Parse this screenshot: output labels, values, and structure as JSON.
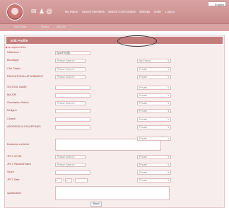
{
  "header": {
    "language": "English",
    "icons": [
      "envelope-icon",
      "people-icon",
      "at-icon"
    ],
    "nav": [
      "My Home",
      "Search Members",
      "Search Communities",
      "Settings",
      "Invite",
      "Logout"
    ]
  },
  "subnav": [
    "Edit Profile",
    "Photos",
    "Edit Info"
  ],
  "panel_title": "Edit Profile",
  "required_note": "▶ is required field.",
  "fields": [
    {
      "label": "Nickname *",
      "type": "text",
      "value": "SpanPS(綬)"
    },
    {
      "label": "Bloodtype",
      "type": "select",
      "value": "Please Select",
      "privacy": "My Friend"
    },
    {
      "label": "Civil Status",
      "type": "select",
      "value": "Please Select",
      "privacy": "Private"
    },
    {
      "label": "EDUCATIONAL ATTAINMENT",
      "type": "select",
      "value": "Please Select",
      "privacy": "Private"
    },
    {
      "label": "SCHOOL NAME",
      "type": "text",
      "value": "",
      "privacy": "Private"
    },
    {
      "label": "MAJOR",
      "type": "text",
      "value": "",
      "privacy": "Private"
    },
    {
      "label": "Graduation Status",
      "type": "select",
      "value": "Please Select",
      "privacy": "Private"
    },
    {
      "label": "Religion",
      "type": "text",
      "value": "",
      "privacy": "Private"
    },
    {
      "label": "Church",
      "type": "text",
      "value": "",
      "privacy": "Private"
    },
    {
      "label": "ADDRESS IN PHILIPPINES",
      "type": "text",
      "value": "",
      "privacy": "Private"
    },
    {
      "label": "Business contents",
      "type": "textarea",
      "value": "",
      "privacy": "Private"
    },
    {
      "label": "JPLT LEVEL",
      "type": "select",
      "value": "Please Select",
      "privacy": "Private"
    },
    {
      "label": "JPLT Passed/Failed",
      "type": "select",
      "value": "Please Select",
      "privacy": "Private"
    },
    {
      "label": "Score",
      "type": "text",
      "value": "",
      "privacy": "Private"
    },
    {
      "label": "JPLT Date",
      "type": "date",
      "value": "",
      "privacy": "Private"
    },
    {
      "label": "qualification",
      "type": "textarea",
      "value": ""
    }
  ],
  "date_parts": [
    "▾",
    "▾"
  ],
  "send_label": "Send",
  "colors": {
    "header": "#c98a8a",
    "panel_head": "#c27c7c",
    "panel_bg": "#f8eded",
    "label": "#994444"
  }
}
